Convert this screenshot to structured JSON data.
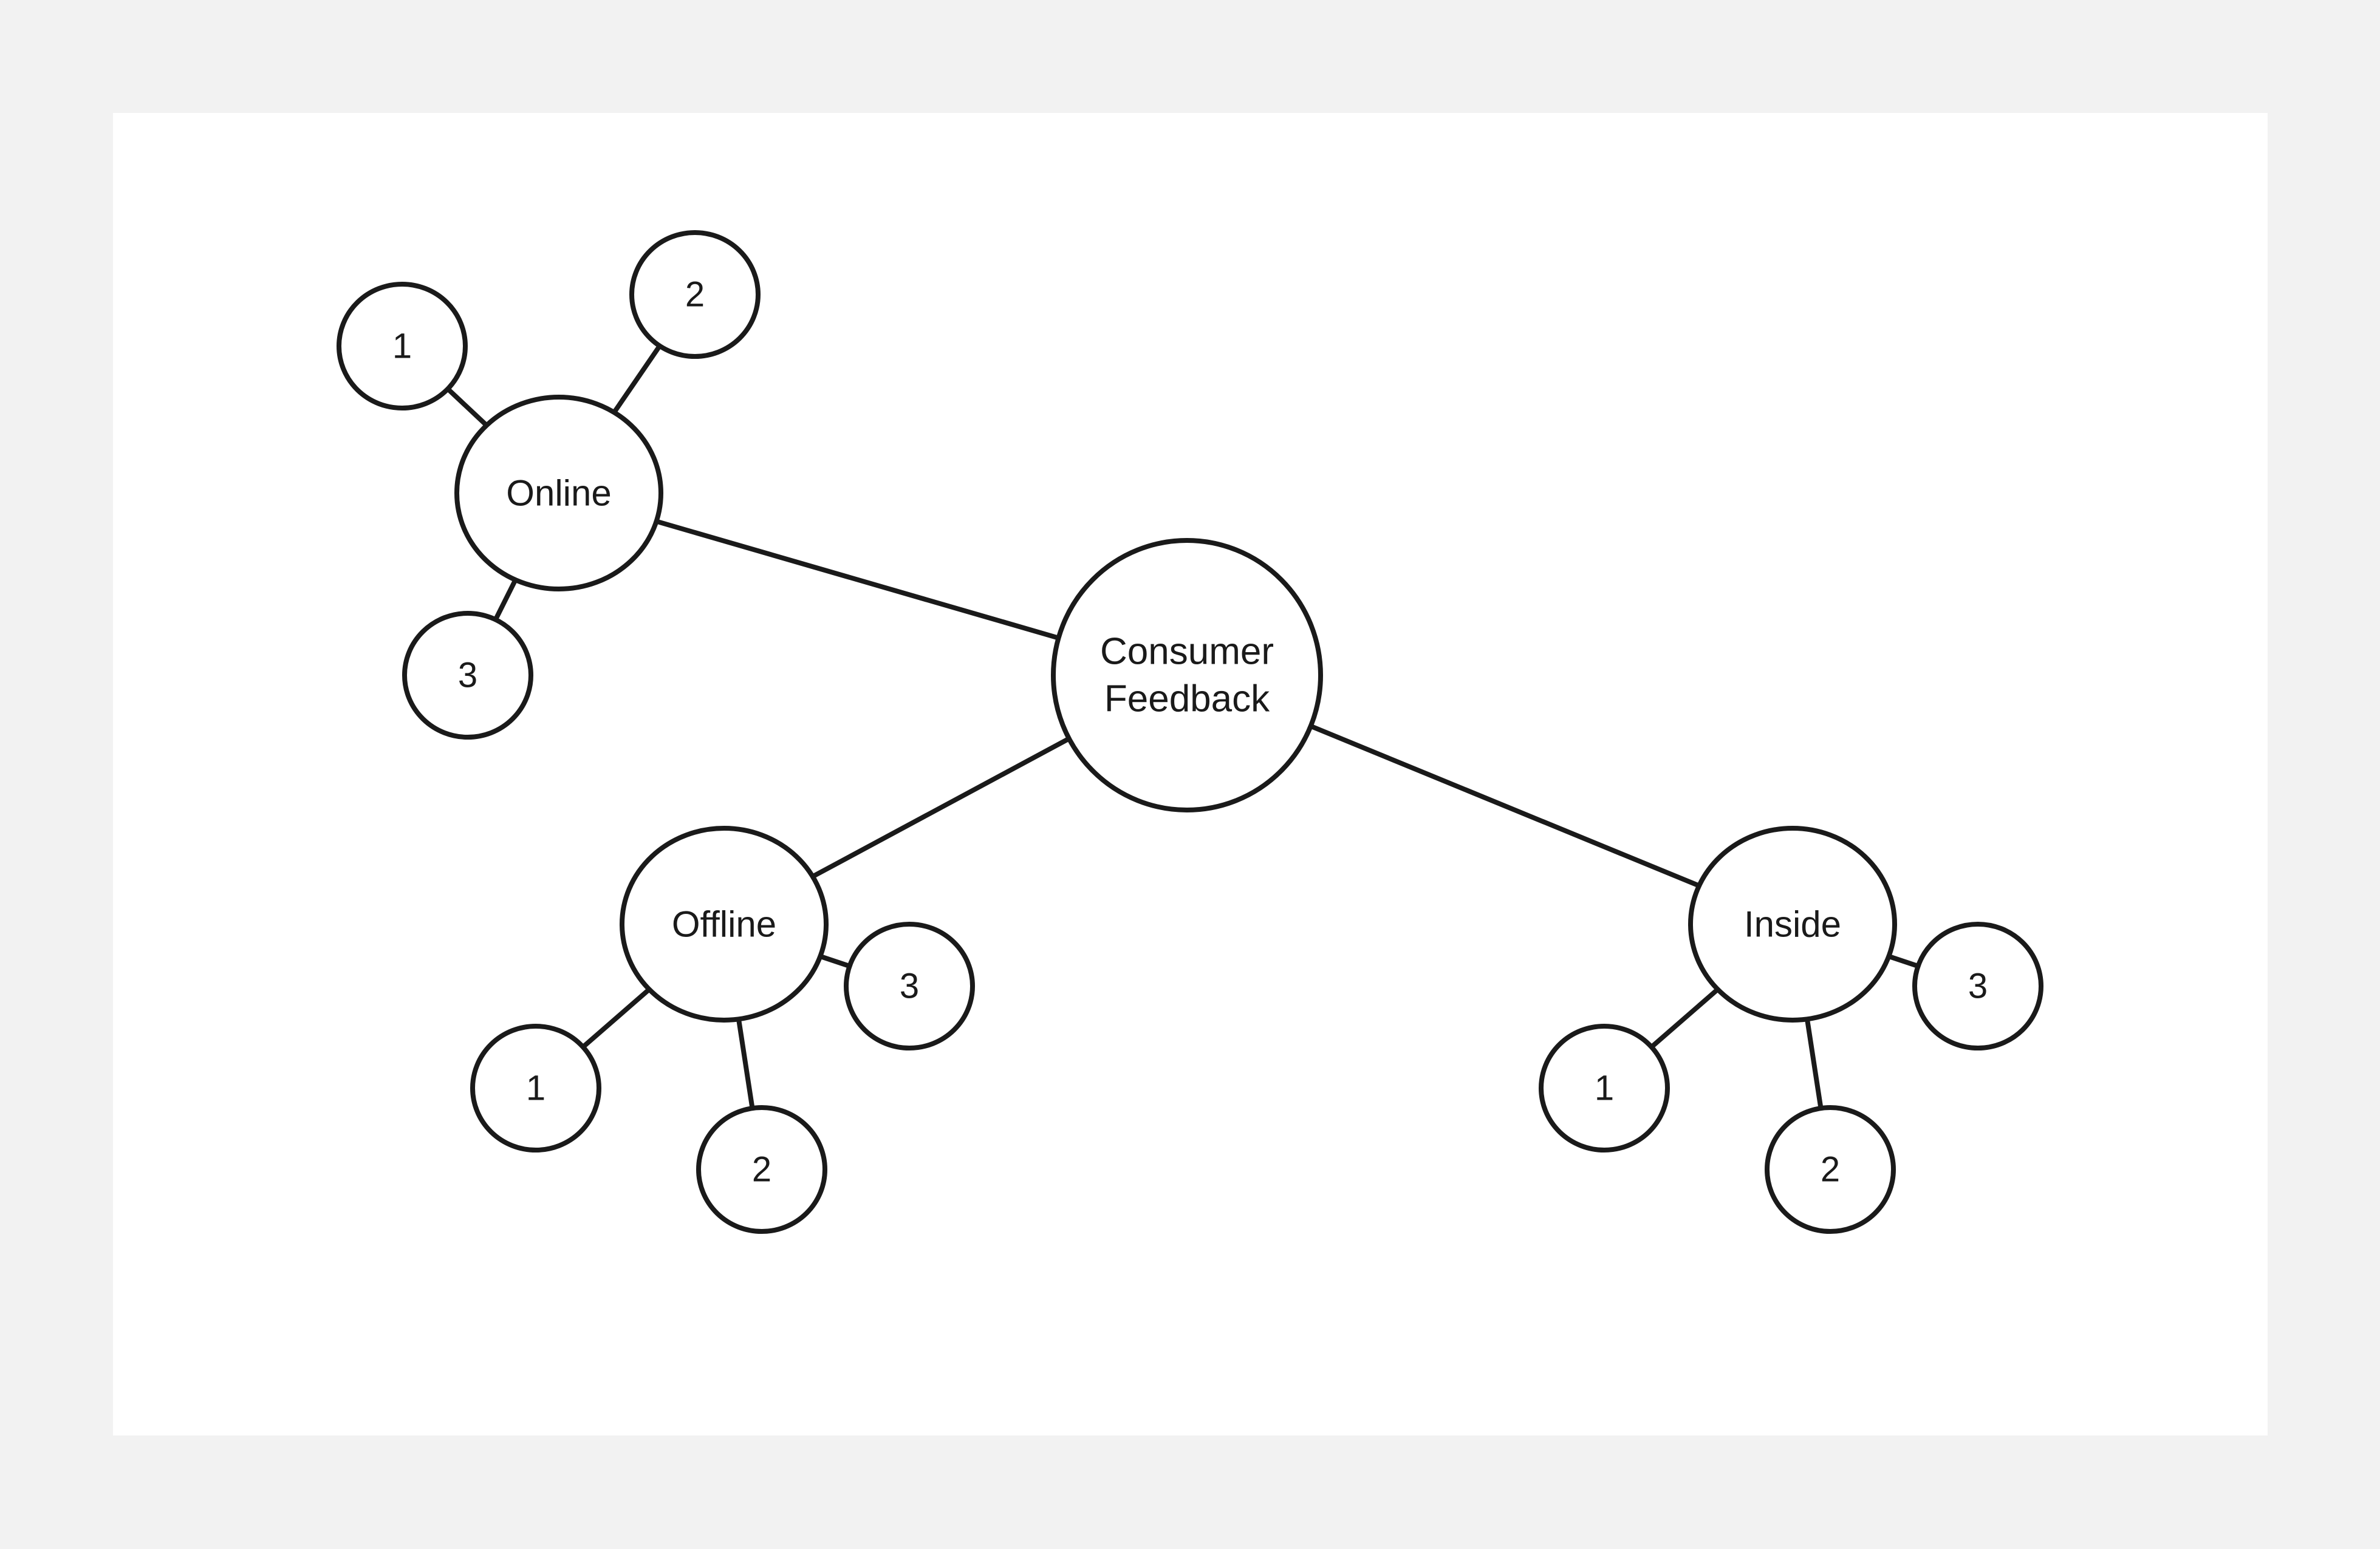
{
  "diagram": {
    "type": "mind-map",
    "colors": {
      "background": "#f2f2f2",
      "canvas": "#ffffff",
      "stroke": "#1a1a1a",
      "text": "#1a1a1a"
    },
    "root": {
      "id": "consumer-feedback",
      "label_lines": [
        "Consumer",
        "Feedback"
      ]
    },
    "branches": [
      {
        "id": "online",
        "label": "Online",
        "children": [
          {
            "id": "online-1",
            "label": "1"
          },
          {
            "id": "online-2",
            "label": "2"
          },
          {
            "id": "online-3",
            "label": "3"
          }
        ]
      },
      {
        "id": "offline",
        "label": "Offline",
        "children": [
          {
            "id": "offline-1",
            "label": "1"
          },
          {
            "id": "offline-2",
            "label": "2"
          },
          {
            "id": "offline-3",
            "label": "3"
          }
        ]
      },
      {
        "id": "inside",
        "label": "Inside",
        "children": [
          {
            "id": "inside-1",
            "label": "1"
          },
          {
            "id": "inside-2",
            "label": "2"
          },
          {
            "id": "inside-3",
            "label": "3"
          }
        ]
      }
    ],
    "edges": [
      [
        "consumer-feedback",
        "online"
      ],
      [
        "consumer-feedback",
        "offline"
      ],
      [
        "consumer-feedback",
        "inside"
      ],
      [
        "online",
        "online-1"
      ],
      [
        "online",
        "online-2"
      ],
      [
        "online",
        "online-3"
      ],
      [
        "offline",
        "offline-1"
      ],
      [
        "offline",
        "offline-2"
      ],
      [
        "offline",
        "offline-3"
      ],
      [
        "inside",
        "inside-1"
      ],
      [
        "inside",
        "inside-2"
      ],
      [
        "inside",
        "inside-3"
      ]
    ]
  }
}
